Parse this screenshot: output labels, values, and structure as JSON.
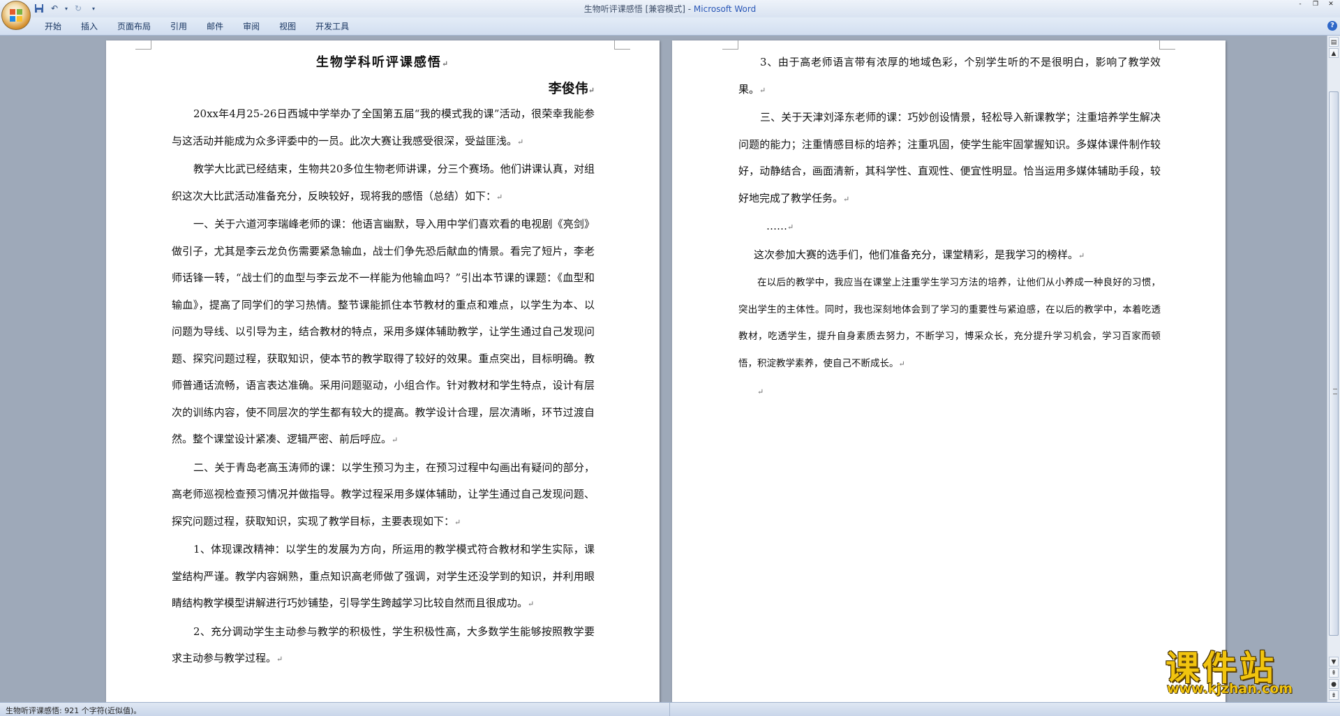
{
  "window": {
    "doc_name": "生物听评课感悟 [兼容模式] - ",
    "app_name": "Microsoft Word",
    "controls": [
      "-",
      "❐",
      "✕"
    ]
  },
  "ribbon": {
    "tabs": [
      "开始",
      "插入",
      "页面布局",
      "引用",
      "邮件",
      "审阅",
      "视图",
      "开发工具"
    ],
    "help": "?"
  },
  "page1": {
    "title": "生物学科听评课感悟",
    "author": "李俊伟",
    "paragraphs": [
      "20xx年4月25-26日西城中学举办了全国第五届“我的模式我的课”活动，很荣幸我能参与这活动并能成为众多评委中的一员。此次大赛让我感受很深，受益匪浅。",
      "教学大比武已经结束，生物共20多位生物老师讲课，分三个赛场。他们讲课认真，对组织这次大比武活动准备充分，反映较好，现将我的感悟（总结）如下：",
      "一、关于六道河李瑞峰老师的课：他语言幽默，导入用中学们喜欢看的电视剧《亮剑》做引子，尤其是李云龙负伤需要紧急输血，战士们争先恐后献血的情景。看完了短片，李老师话锋一转，“战士们的血型与李云龙不一样能为他输血吗？”引出本节课的课题：《血型和输血》，提高了同学们的学习热情。整节课能抓住本节教材的重点和难点，以学生为本、以问题为导线、以引导为主，结合教材的特点，采用多媒体辅助教学，让学生通过自己发现问题、探究问题过程，获取知识，使本节的教学取得了较好的效果。重点突出，目标明确。教师普通话流畅，语言表达准确。采用问题驱动，小组合作。针对教材和学生特点，设计有层次的训练内容，使不同层次的学生都有较大的提高。教学设计合理，层次清晰，环节过渡自然。整个课堂设计紧凑、逻辑严密、前后呼应。",
      "二、关于青岛老高玉涛师的课：以学生预习为主，在预习过程中勾画出有疑问的部分，高老师巡视检查预习情况并做指导。教学过程采用多媒体辅助，让学生通过自己发现问题、探究问题过程，获取知识，实现了教学目标，主要表现如下：",
      "1、体现课改精神：以学生的发展为方向，所运用的教学模式符合教材和学生实际，课堂结构严谨。教学内容娴熟，重点知识高老师做了强调，对学生还没学到的知识，并利用眼睛结构教学模型讲解进行巧妙铺垫，引导学生跨越学习比较自然而且很成功。",
      "2、充分调动学生主动参与教学的积极性，学生积极性高，大多数学生能够按照教学要求主动参与教学过程。"
    ]
  },
  "page2": {
    "paragraphs": [
      "3、由于高老师语言带有浓厚的地域色彩，个别学生听的不是很明白，影响了教学效果。",
      "三、关于天津刘泽东老师的课：巧妙创设情景，轻松导入新课教学；注重培养学生解决问题的能力；注重情感目标的培养；注重巩固，使学生能牢固掌握知识。多媒体课件制作较好，动静结合，画面清新，其科学性、直观性、便宜性明显。恰当运用多媒体辅助手段，较好地完成了教学任务。",
      "……",
      "这次参加大赛的选手们，他们准备充分，课堂精彩，是我学习的榜样。"
    ],
    "small_paragraph": "在以后的教学中，我应当在课堂上注重学生学习方法的培养，让他们从小养成一种良好的习惯，突出学生的主体性。同时，我也深刻地体会到了学习的重要性与紧迫感，在以后的教学中，本着吃透教材，吃透学生，提升自身素质去努力，不断学习，博采众长，充分提升学习机会，学习百家而顿悟，积淀教学素养，使自己不断成长。",
    "para_mark": "↵"
  },
  "statusbar": {
    "text": "生物听评课感悟: 921 个字符(近似值)。"
  },
  "watermark": {
    "main": "课件站",
    "url": "www.kjzhan.com"
  }
}
